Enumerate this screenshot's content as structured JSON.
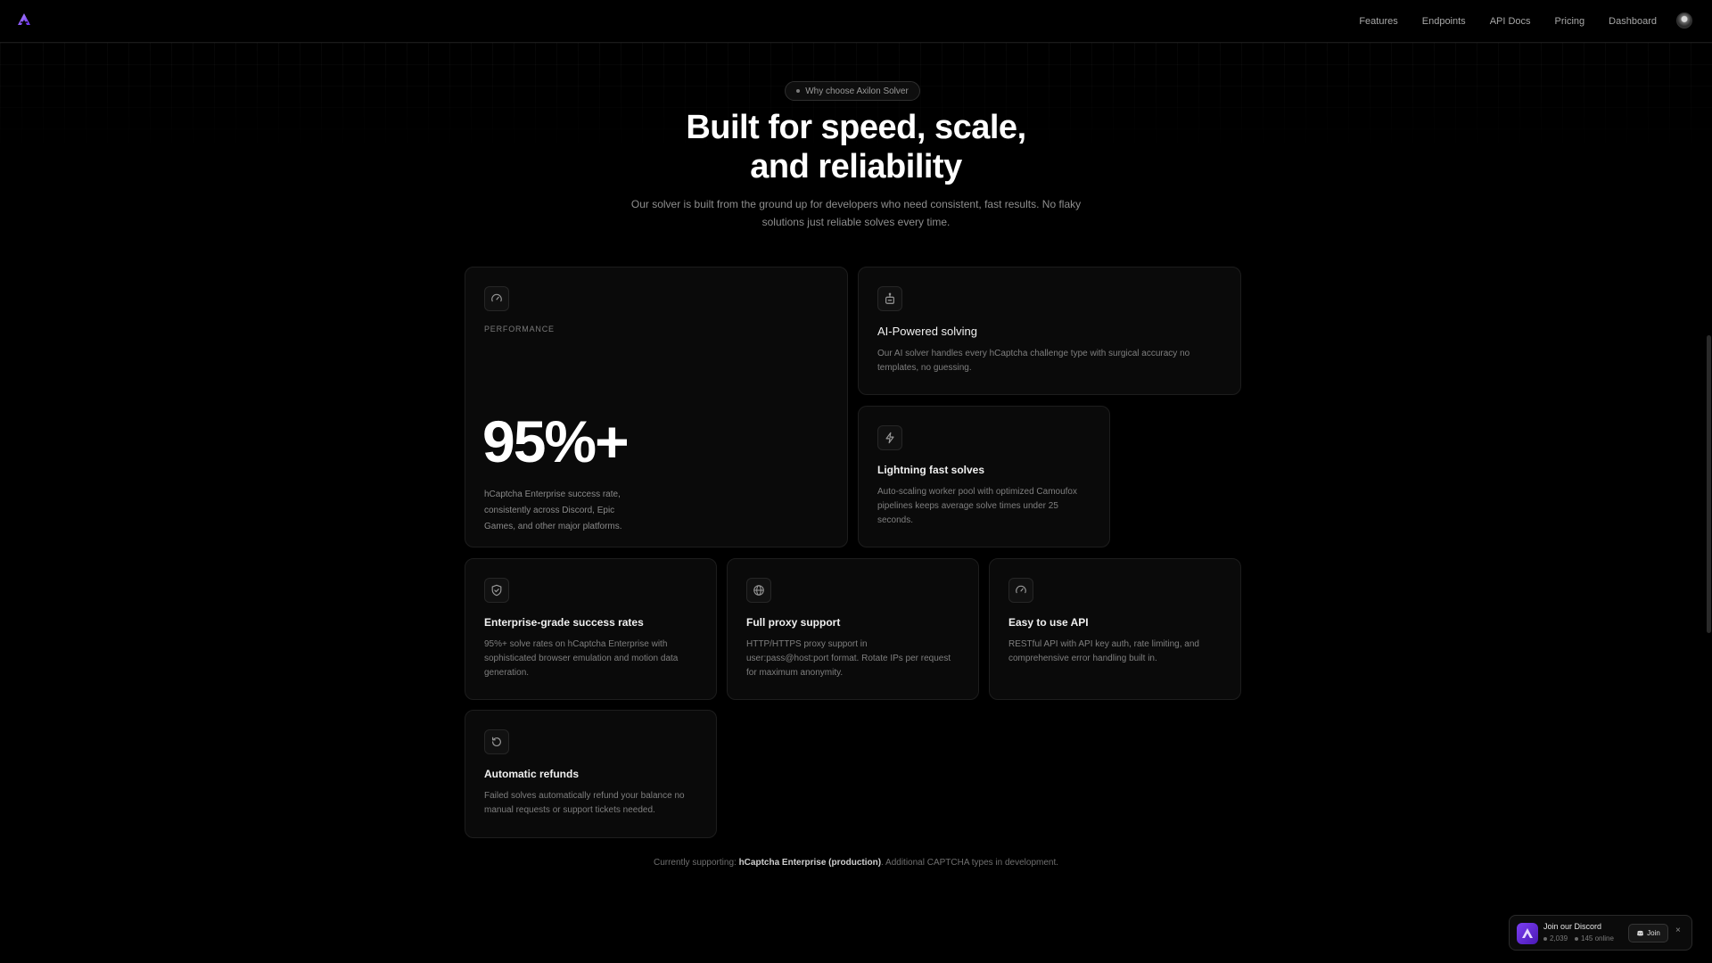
{
  "nav": {
    "links": [
      "Features",
      "Endpoints",
      "API Docs",
      "Pricing",
      "Dashboard"
    ]
  },
  "hero": {
    "pill": "Why choose Axilon Solver",
    "title_line1": "Built for speed, scale,",
    "title_line2": "and reliability",
    "subtitle": "Our solver is built from the ground up for developers who need consistent, fast results. No flaky solutions just reliable solves every time."
  },
  "performance": {
    "label": "PERFORMANCE",
    "stat": "95%+",
    "description": "hCaptcha Enterprise success rate, consistently across Discord, Epic Games, and other major platforms."
  },
  "features": [
    {
      "title": "AI-Powered solving",
      "description": "Our AI solver handles every hCaptcha challenge type with surgical accuracy no templates, no guessing.",
      "icon": "robot-icon"
    },
    {
      "title": "Lightning fast solves",
      "description": "Auto-scaling worker pool with optimized Camoufox pipelines keeps average solve times under 25 seconds.",
      "icon": "lightning-icon"
    },
    {
      "title": "Enterprise-grade success rates",
      "description": "95%+ solve rates on hCaptcha Enterprise with sophisticated browser emulation and motion data generation.",
      "icon": "shield-check-icon"
    },
    {
      "title": "Full proxy support",
      "description": "HTTP/HTTPS proxy support in user:pass@host:port format. Rotate IPs per request for maximum anonymity.",
      "icon": "globe-icon"
    },
    {
      "title": "Easy to use API",
      "description": "RESTful API with API key auth, rate limiting, and comprehensive error handling built in.",
      "icon": "gauge-icon"
    },
    {
      "title": "Automatic refunds",
      "description": "Failed solves automatically refund your balance no manual requests or support tickets needed.",
      "icon": "refund-icon"
    }
  ],
  "footer": {
    "prefix": "Currently supporting:",
    "highlight": "hCaptcha Enterprise (production)",
    "suffix": ". Additional CAPTCHA types in development."
  },
  "discord_toast": {
    "title": "Join our Discord",
    "members": "2,039",
    "online": "145 online",
    "join_label": "Join",
    "close": "×"
  },
  "colors": {
    "background": "#000000",
    "card": "#0a0a0a",
    "card_border": "#1d1d1d",
    "accent_purple": "#7b3ff2"
  }
}
